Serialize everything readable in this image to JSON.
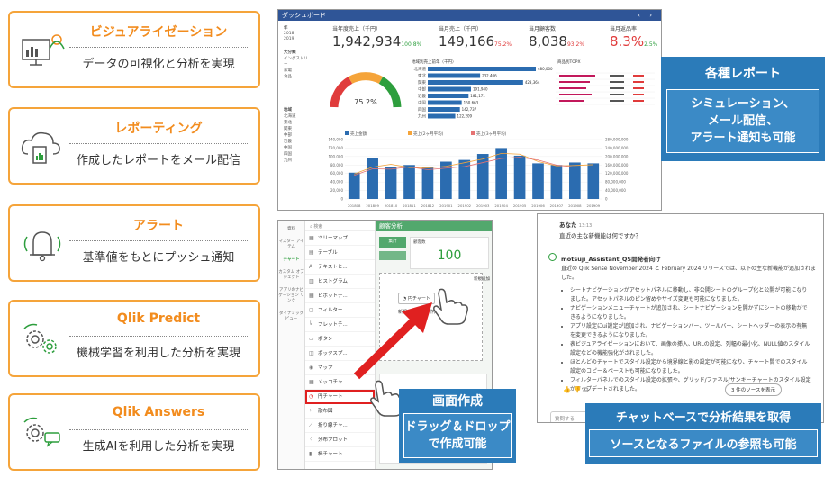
{
  "features": [
    {
      "title": "ビジュアライゼーション",
      "desc": "データの可視化と分析を実現",
      "icon": "dashboard-icon"
    },
    {
      "title": "レポーティング",
      "desc": "作成したレポートをメール配信",
      "icon": "cloud-report-icon"
    },
    {
      "title": "アラート",
      "desc": "基準値をもとにプッシュ通知",
      "icon": "bell-icon"
    },
    {
      "title": "Qlik Predict",
      "desc": "機械学習を利用した分析を実現",
      "icon": "gears-icon"
    },
    {
      "title": "Qlik Answers",
      "desc": "生成AIを利用した分析を実現",
      "icon": "gear-chat-icon"
    }
  ],
  "dashboard": {
    "title": "ダッシュボード",
    "kpis": [
      {
        "label": "当年度売上（千円）",
        "value": "1,942,934",
        "delta": "100.8%"
      },
      {
        "label": "当月売上（千円）",
        "value": "149,166",
        "delta": "75.2%"
      },
      {
        "label": "当月顧客数",
        "value": "8,038",
        "delta": "93.2%"
      },
      {
        "label": "当月返品率",
        "value": "8.3%",
        "delta": "2.5%"
      }
    ],
    "gauge_value": "75.2%",
    "region_title": "地域別売上前年（千円）",
    "ranking_title": "商品別TOPX",
    "filters": {
      "year_head": "年",
      "years": [
        "2018",
        "2019"
      ],
      "industry_head": "大分類",
      "industries": [
        "インダストリー",
        "家電",
        "食品"
      ],
      "region_head": "地域",
      "regions": [
        "北海道",
        "東北",
        "関東",
        "中部",
        "近畿",
        "中国",
        "四国",
        "九州"
      ]
    }
  },
  "callouts": {
    "report_title": "各種レポート",
    "report_lines": [
      "シミュレーション、",
      "メール配信、",
      "アラート通知も可能"
    ],
    "create_title": "画面作成",
    "create_lines": [
      "ドラッグ＆ドロップ",
      "で作成可能"
    ],
    "chat_title": "チャットベースで分析結果を取得",
    "chat_sub": "ソースとなるファイルの参照も可能"
  },
  "builder": {
    "search_placeholder": "検索",
    "rail": [
      "資料",
      "マスター アイテム",
      "チャート",
      "カスタム オブジェクト",
      "アプリのナビゲーション リンク",
      "ダイナミック ビュー"
    ],
    "items": [
      "ツリーマップ",
      "テーブル",
      "テキストと...",
      "ヒストグラム",
      "ピボットテ...",
      "フィルター...",
      "フレットチ...",
      "ボタン",
      "ボックスプ...",
      "マップ",
      "メッコチャ...",
      "円チャート",
      "散布図",
      "折り線チャ...",
      "分布プロット",
      "棒チャート"
    ],
    "sheet_title": "顧客分析",
    "tile_label": "集計",
    "kpi_title": "顧客数",
    "kpi_value": "100",
    "drag_chip": "円チャート",
    "drop_label": "新規チャートの作成",
    "new_area": "新規追加"
  },
  "chat": {
    "user_name": "あなた",
    "user_time": "13:13",
    "user_msg": "直近の主な新機能は何ですか？",
    "bot_name": "motsuji_Assistant_QS開発者向け",
    "intro": "直近の Qlik Sense November 2024 と February 2024 リリースでは、以下の主な新機能が追加されました。",
    "bullets": [
      "シートナビゲーションがアセットパネルに移動し、非公開シートのグループ化と公開が可能になりました。アセットパネルのピン留めやサイズ変更も可能になりました。",
      "ナビゲーションメニューチャートが追加され、シートナビゲーションを開かずにシートの移動ができるようになりました。",
      "アプリ設定にui設定が追加され、ナビゲーションバー、ツールバー、シートヘッダーの表示の有無を変更できるようになりました。",
      "表ビジュアライゼーションにおいて、画像の挿入、URLの設定、列幅の最小化、NULL値のスタイル設定などの機能強化がされました。",
      "ほとんどのチャートでスタイル設定から境界線と影の設定が可能になり、チャート間でのスタイル設定のコピー＆ペーストも可能になりました。",
      "フィルターパネルでのスタイル設定の拡張や、グリッド/ファネル/サンキーチャートのスタイル設定がアップデートされました。"
    ],
    "sources_button": "3 件のソースを表示",
    "input_placeholder": "質問する"
  },
  "chart_data": [
    {
      "type": "bar",
      "title": "地域別売上前年（千円）",
      "categories": [
        "北海道",
        "東北",
        "関東",
        "中部",
        "近畿",
        "中国",
        "四国",
        "九州"
      ],
      "values": [
        480000,
        232406,
        423364,
        191940,
        181171,
        150663,
        142737,
        122209
      ]
    },
    {
      "type": "bar",
      "legend": [
        "売上金額",
        "売上(2ヶ月平均)",
        "売上(3ヶ月平均)"
      ],
      "categories": [
        "201808",
        "201809",
        "201810",
        "201811",
        "201812",
        "201901",
        "201902",
        "201903",
        "201904",
        "201905",
        "201906",
        "201907",
        "201908",
        "201909"
      ],
      "values": [
        62000,
        96000,
        76000,
        80000,
        74000,
        88000,
        92000,
        106000,
        120000,
        102000,
        84000,
        80000,
        86000,
        84000
      ],
      "ylim": [
        0,
        140000
      ],
      "yticks": [
        "0",
        "20,000",
        "40,000",
        "60,000",
        "80,000",
        "100,000",
        "120,000",
        "140,000"
      ],
      "ylim_right": [
        0,
        280000000
      ],
      "yticks_right": [
        "0",
        "40,000,000",
        "80,000,000",
        "120,000,000",
        "160,000,000",
        "200,000,000",
        "240,000,000",
        "280,000,000"
      ]
    }
  ]
}
